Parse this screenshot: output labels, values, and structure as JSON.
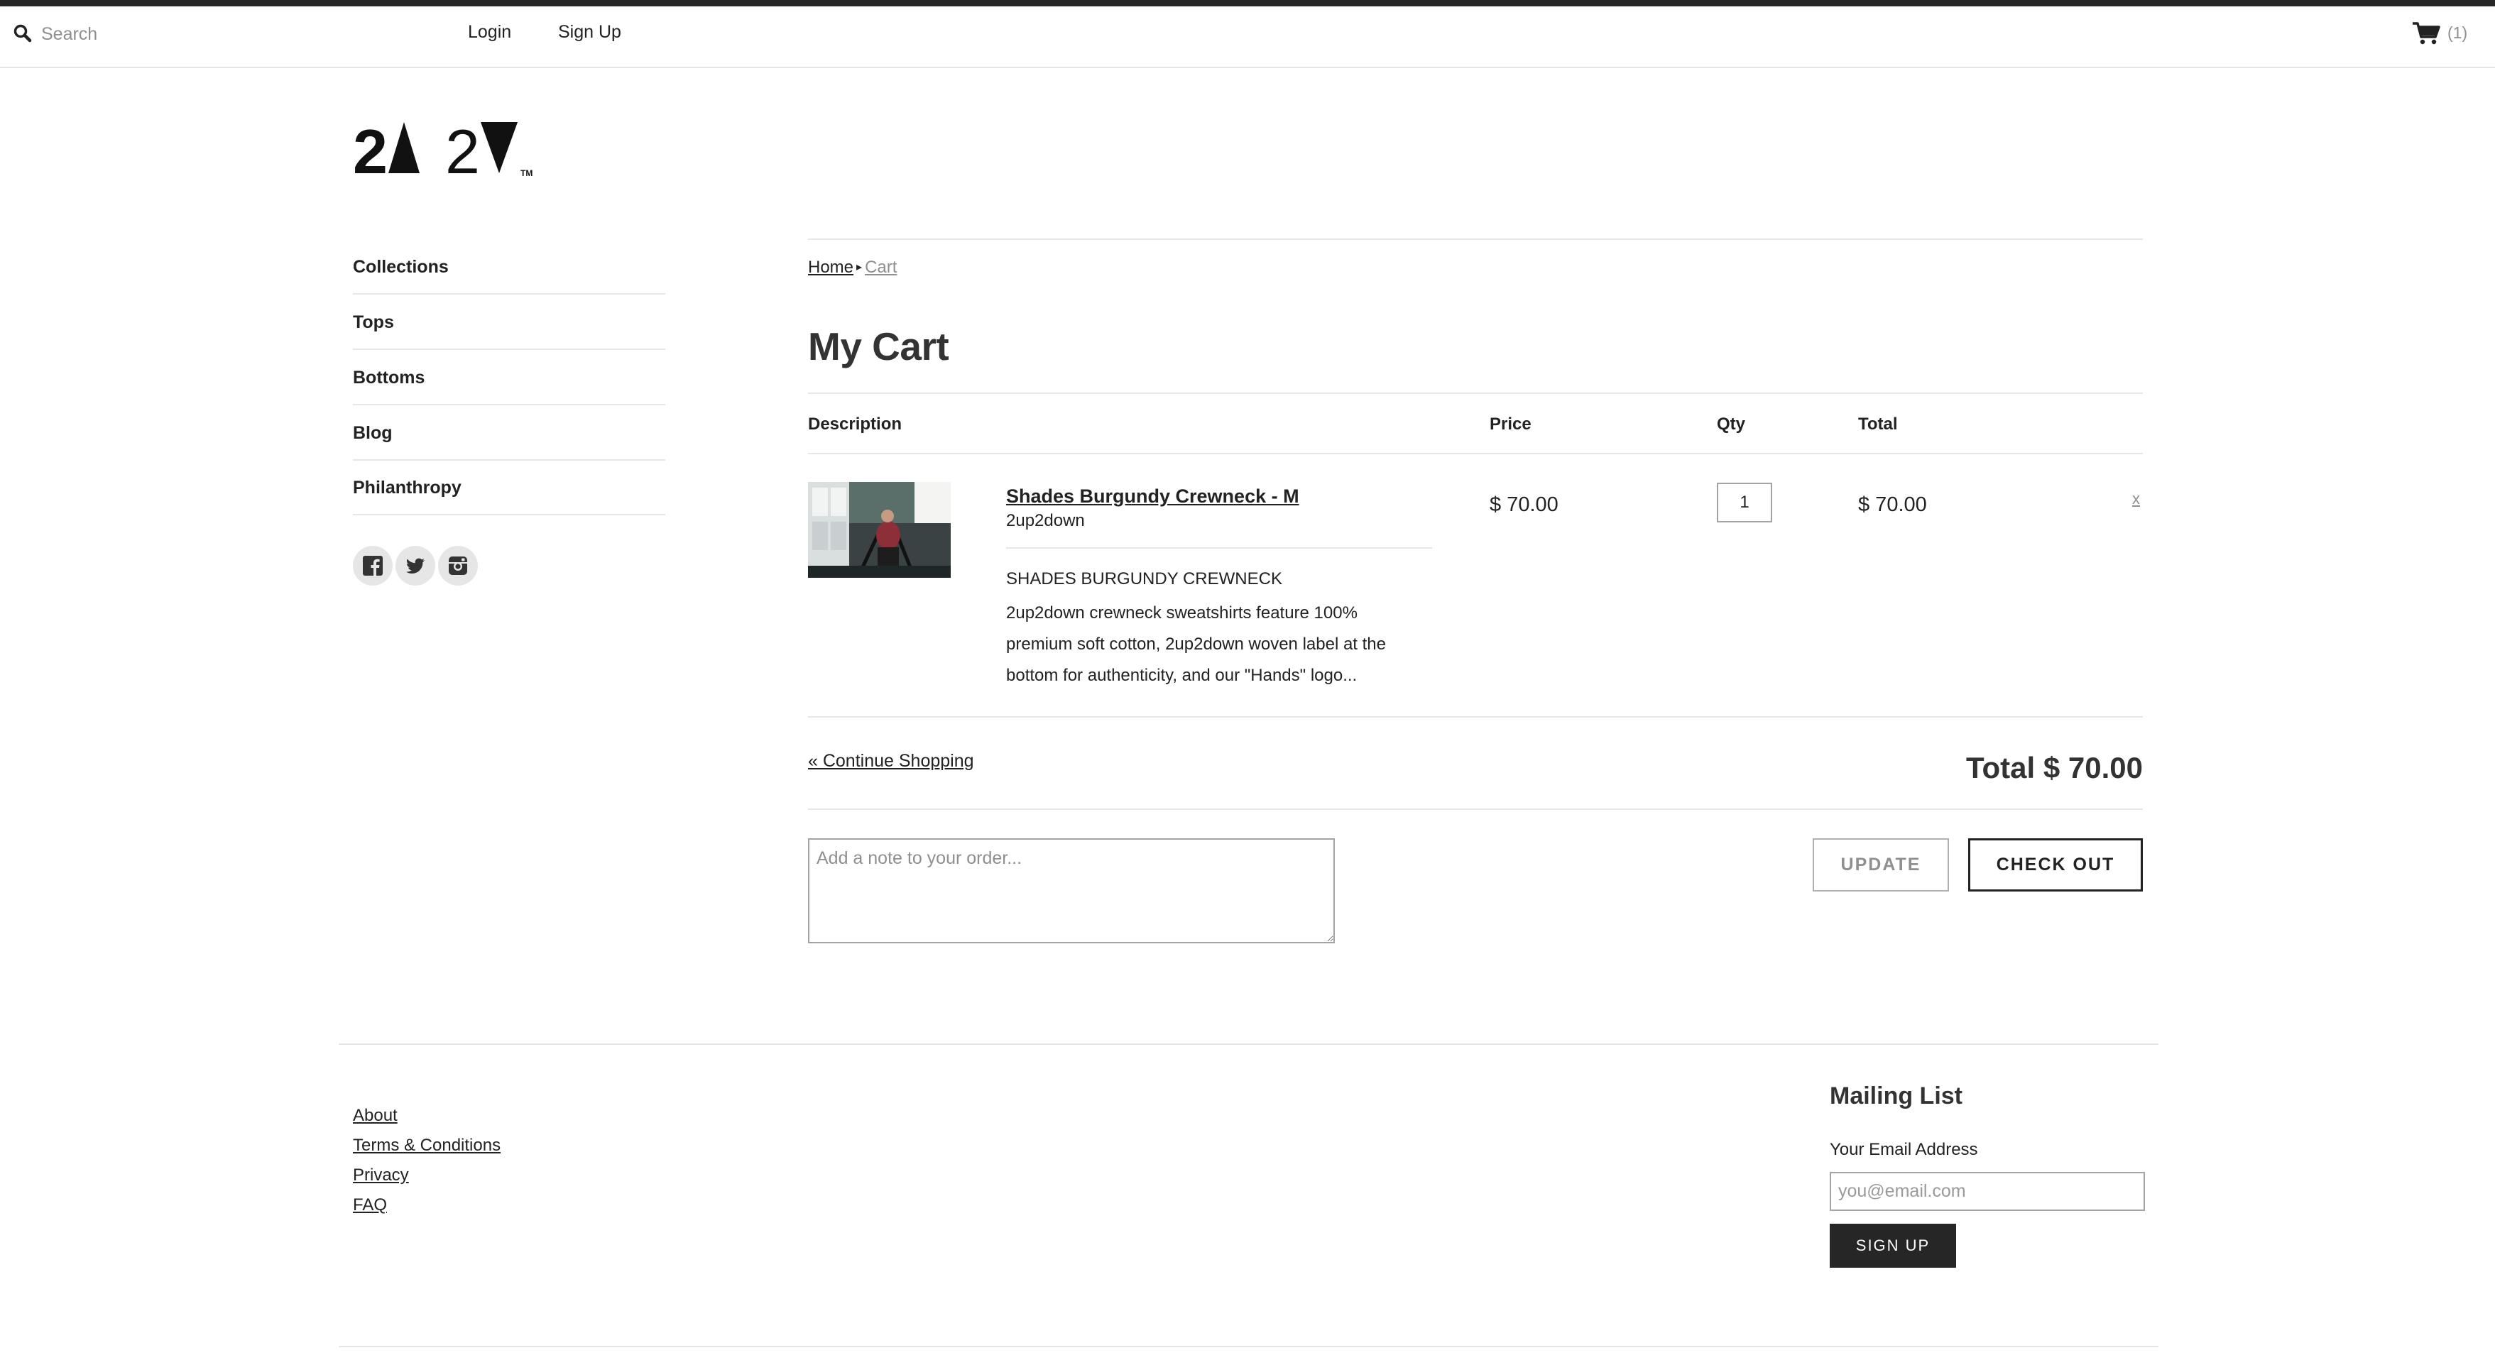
{
  "topbar": {
    "search_placeholder": "Search",
    "login_label": "Login",
    "signup_label": "Sign Up",
    "cart_count": "(1)"
  },
  "logo": {
    "text": "2▲2▼",
    "tm": "TM"
  },
  "sidebar": {
    "items": [
      {
        "label": "Collections"
      },
      {
        "label": "Tops"
      },
      {
        "label": "Bottoms"
      },
      {
        "label": "Blog"
      },
      {
        "label": "Philanthropy"
      }
    ],
    "social": [
      "facebook-icon",
      "twitter-icon",
      "instagram-icon"
    ]
  },
  "breadcrumb": {
    "home": "Home",
    "separator": "▸",
    "current": "Cart"
  },
  "page_title": "My Cart",
  "table": {
    "headers": {
      "description": "Description",
      "price": "Price",
      "qty": "Qty",
      "total": "Total"
    }
  },
  "cart_item": {
    "name": "Shades Burgundy Crewneck - M",
    "vendor": "2up2down",
    "desc_title": "SHADES BURGUNDY CREWNECK",
    "description": "2up2down crewneck sweatshirts feature 100% premium soft cotton, 2up2down woven label at the bottom for authenticity, and our \"Hands\" logo...",
    "price": "$ 70.00",
    "qty": "1",
    "total": "$ 70.00",
    "remove_label": "x"
  },
  "summary": {
    "continue_label": "« Continue Shopping",
    "total_label": "Total $ 70.00",
    "note_placeholder": "Add a note to your order...",
    "update_label": "UPDATE",
    "checkout_label": "CHECK OUT"
  },
  "footer": {
    "links": [
      {
        "label": "About"
      },
      {
        "label": "Terms & Conditions"
      },
      {
        "label": "Privacy"
      },
      {
        "label": "FAQ"
      }
    ],
    "mailing": {
      "title": "Mailing List",
      "email_label": "Your Email Address",
      "email_placeholder": "you@email.com",
      "signup_label": "SIGN UP"
    }
  },
  "colors": {
    "text": "#222222",
    "muted": "#8f8f8f",
    "border": "#e6e6e6",
    "dark": "#262626"
  }
}
